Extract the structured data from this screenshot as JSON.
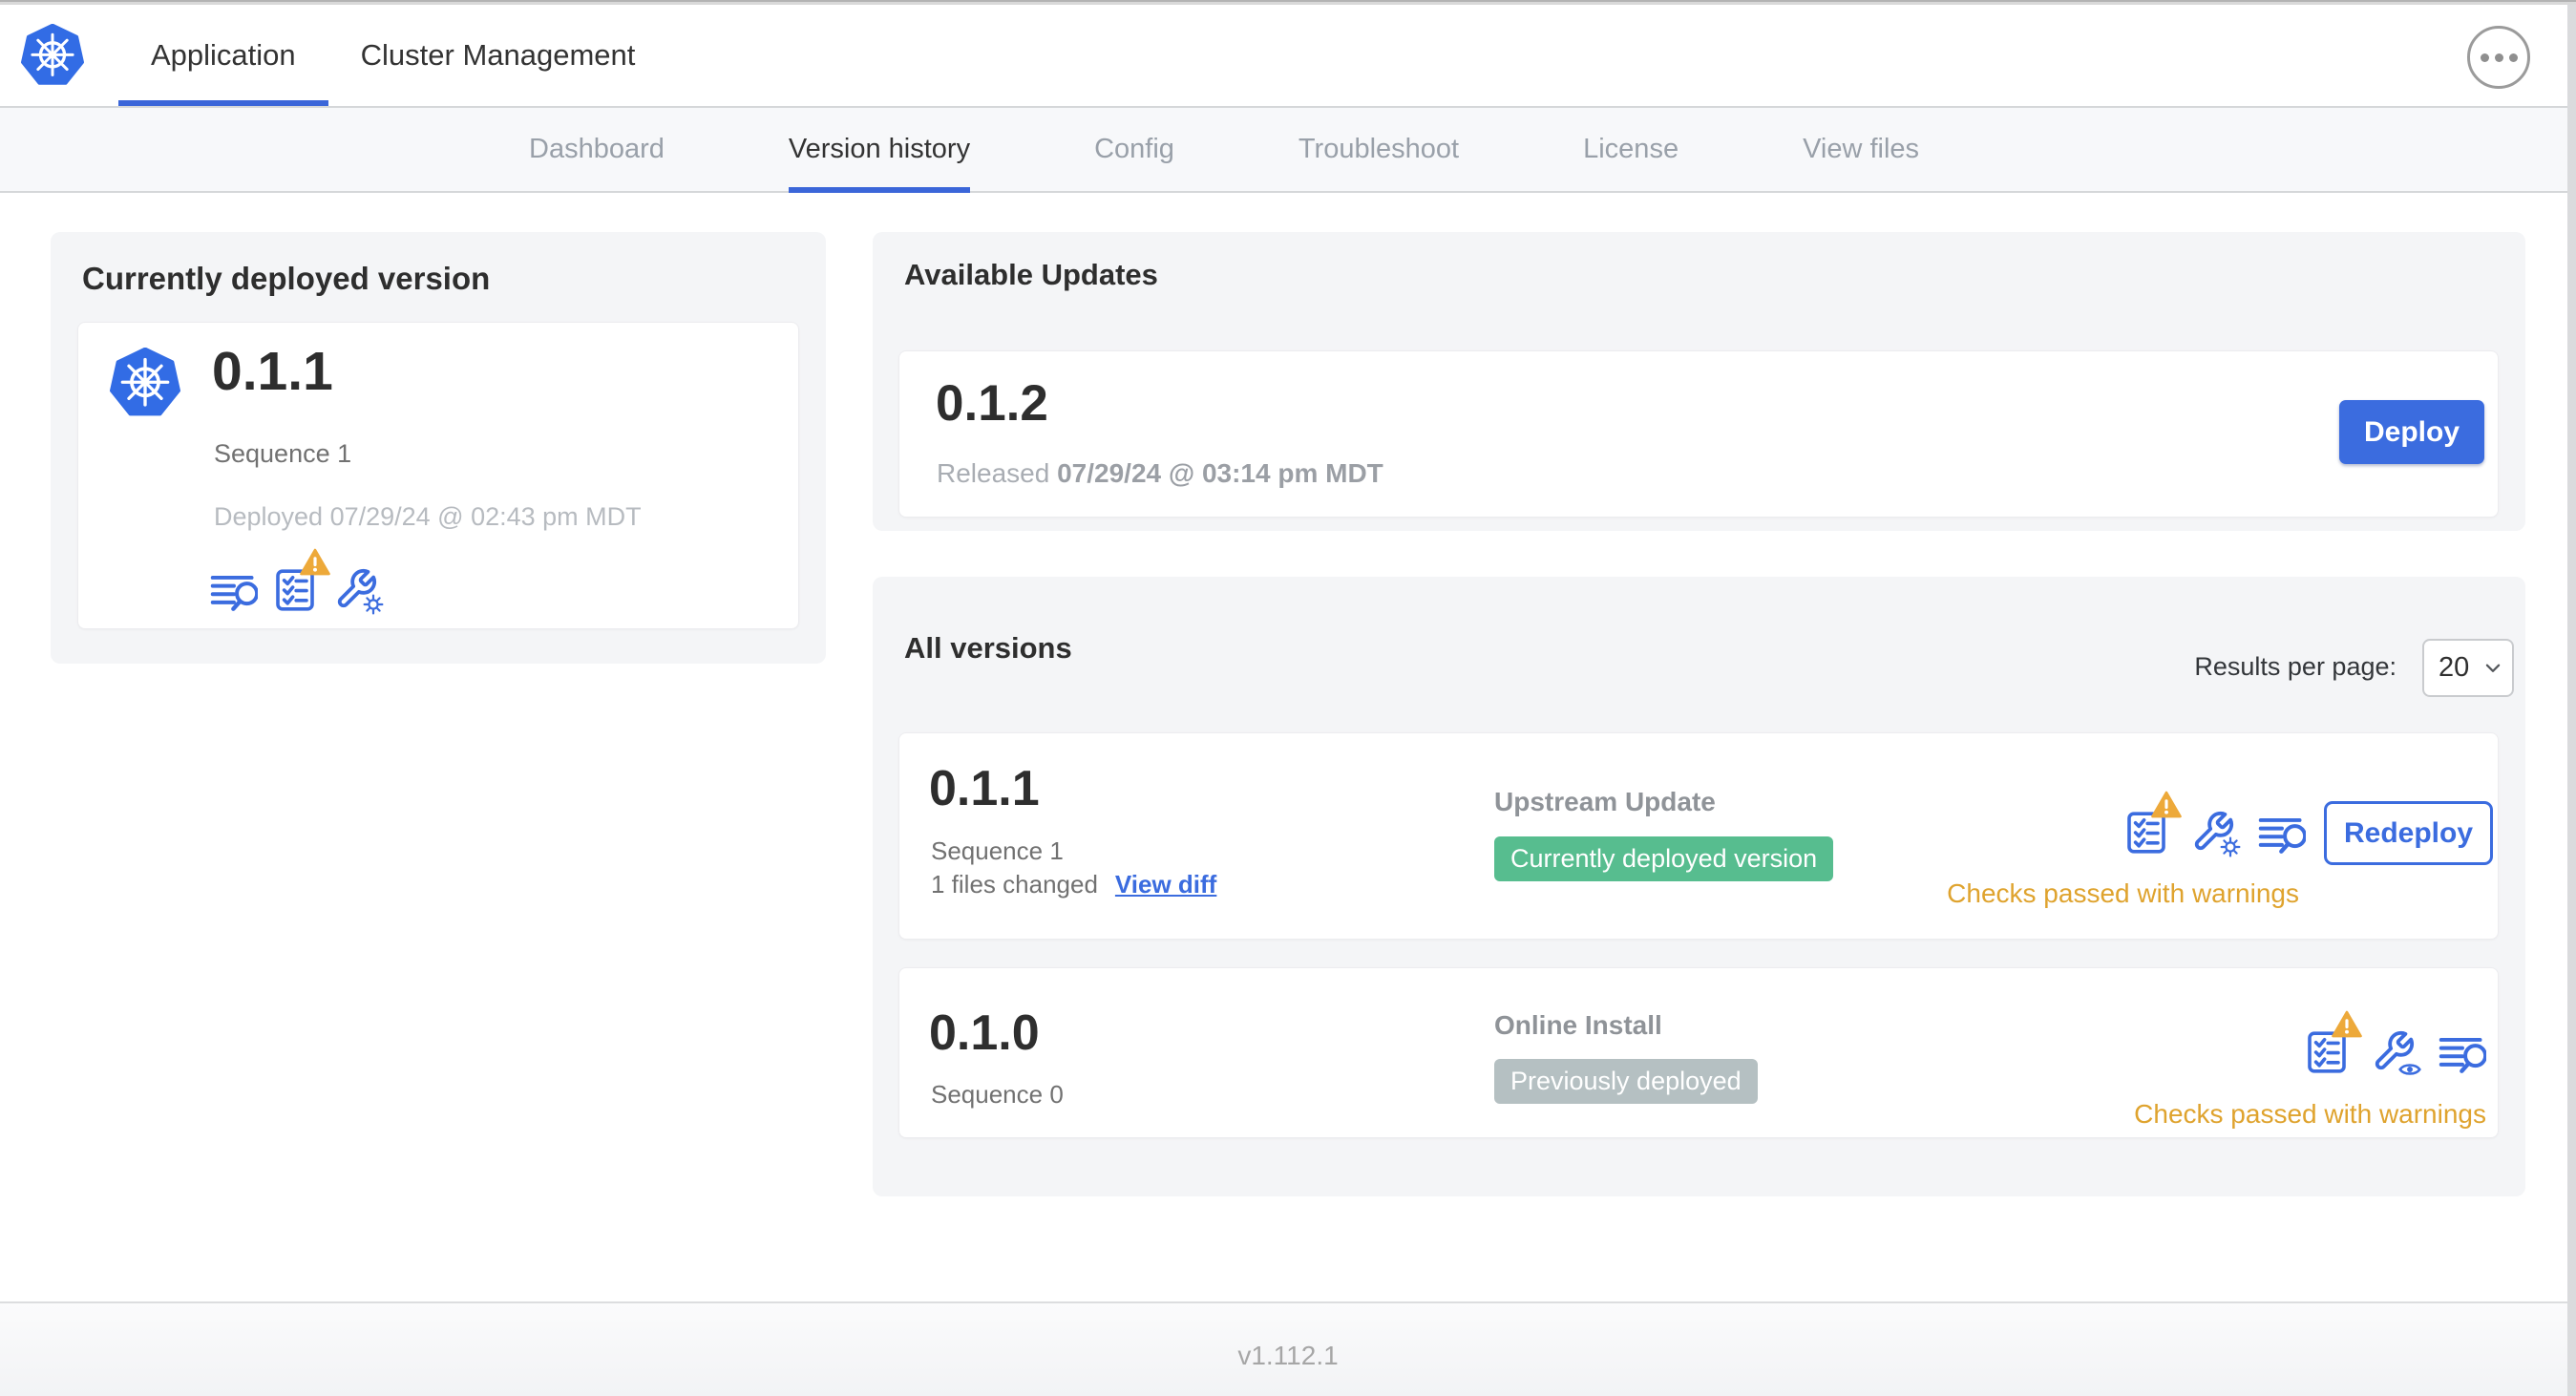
{
  "header": {
    "tabs": [
      {
        "label": "Application",
        "active": true
      },
      {
        "label": "Cluster Management",
        "active": false
      }
    ]
  },
  "subnav": {
    "items": [
      {
        "label": "Dashboard",
        "active": false
      },
      {
        "label": "Version history",
        "active": true
      },
      {
        "label": "Config",
        "active": false
      },
      {
        "label": "Troubleshoot",
        "active": false
      },
      {
        "label": "License",
        "active": false
      },
      {
        "label": "View files",
        "active": false
      }
    ]
  },
  "current_version_card": {
    "title": "Currently deployed version",
    "version": "0.1.1",
    "sequence": "Sequence 1",
    "deployed_at": "Deployed 07/29/24 @ 02:43 pm MDT",
    "icons": [
      "logs",
      "preflight-checks-warning",
      "edit-config"
    ]
  },
  "available_updates": {
    "title": "Available Updates",
    "version": "0.1.2",
    "released_label": "Released",
    "released_at": "07/29/24 @ 03:14 pm MDT",
    "deploy_label": "Deploy"
  },
  "all_versions": {
    "title": "All versions",
    "results_per_page_label": "Results per page:",
    "results_per_page_value": "20",
    "rows": [
      {
        "version": "0.1.1",
        "sequence": "Sequence 1",
        "files_changed": "1 files changed",
        "view_diff_label": "View diff",
        "source": "Upstream Update",
        "badge": "Currently deployed version",
        "badge_color": "green",
        "icons": [
          "preflight-checks-warning",
          "edit-config",
          "logs"
        ],
        "status": "Checks passed with warnings",
        "action_label": "Redeploy"
      },
      {
        "version": "0.1.0",
        "sequence": "Sequence 0",
        "source": "Online Install",
        "badge": "Previously deployed",
        "badge_color": "gray",
        "icons": [
          "preflight-checks-warning",
          "view-config",
          "logs"
        ],
        "status": "Checks passed with warnings"
      }
    ]
  },
  "footer": {
    "app_version": "v1.112.1"
  },
  "colors": {
    "accent_blue": "#3b6cdf",
    "kubernetes_blue": "#326ce5",
    "green_badge": "#57bd8f",
    "gray_badge": "#b5c0c2",
    "warning_text": "#dfa32e",
    "warning_triangle": "#eda93a",
    "card_background": "#f4f5f7"
  }
}
